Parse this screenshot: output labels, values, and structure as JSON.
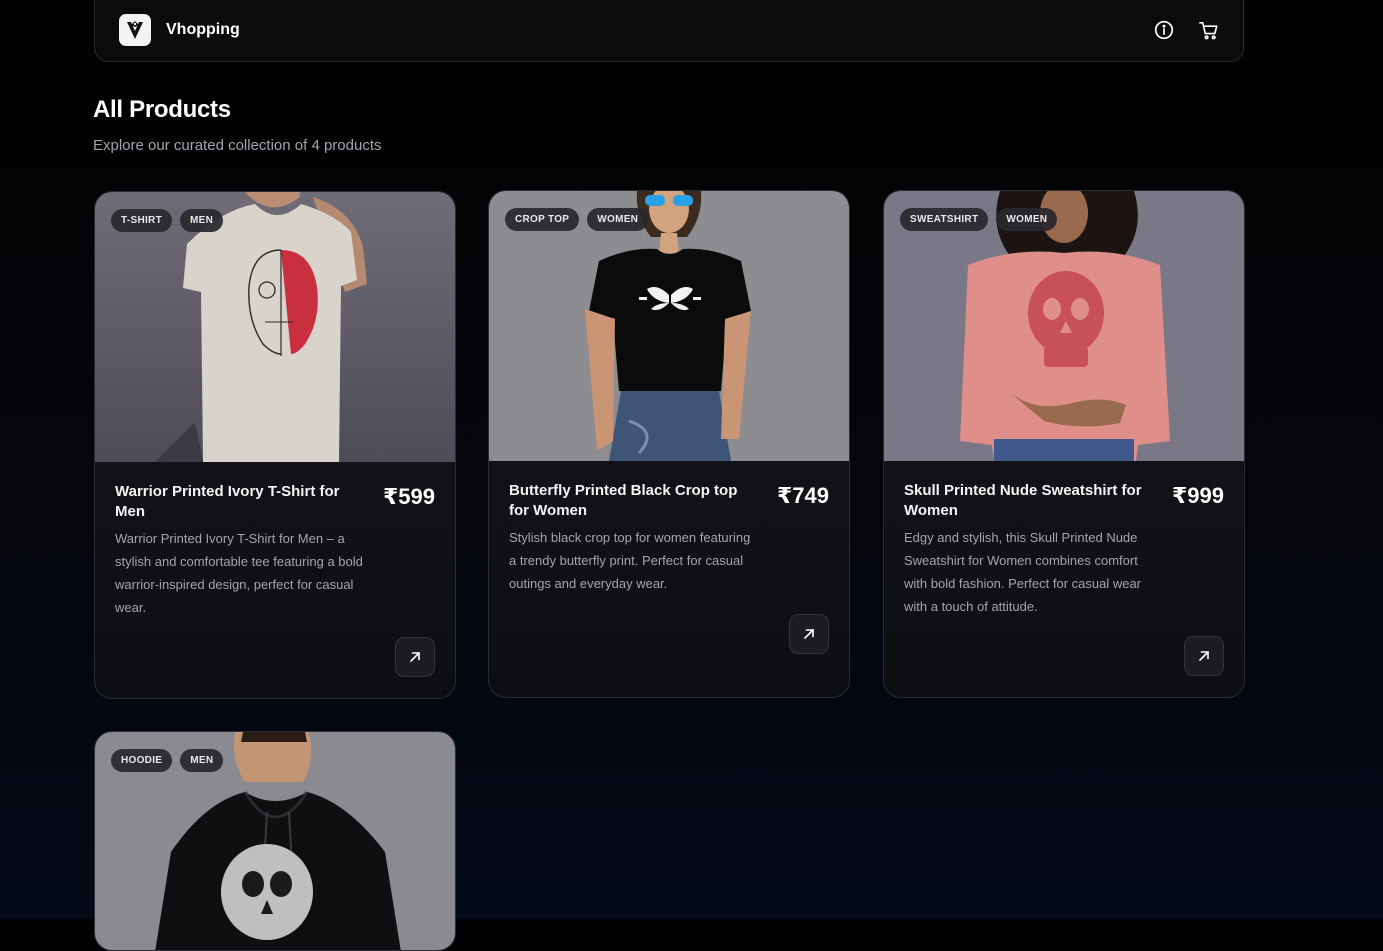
{
  "nav": {
    "brand": "Vhopping",
    "icons": {
      "info": "info-icon",
      "cart": "cart-icon"
    }
  },
  "page": {
    "title": "All Products",
    "subtitle": "Explore our curated collection of 4 products"
  },
  "products": [
    {
      "tags": [
        "T-SHIRT",
        "MEN"
      ],
      "title": "Warrior Printed Ivory T-Shirt for Men",
      "price": "₹599",
      "description": "Warrior Printed Ivory T-Shirt for Men – a stylish and comfortable tee featuring a bold warrior-inspired design, perfect for casual wear."
    },
    {
      "tags": [
        "CROP TOP",
        "WOMEN"
      ],
      "title": "Butterfly Printed Black Crop top for Women",
      "price": "₹749",
      "description": "Stylish black crop top for women featuring a trendy butterfly print. Perfect for casual outings and everyday wear."
    },
    {
      "tags": [
        "SWEATSHIRT",
        "WOMEN"
      ],
      "title": "Skull Printed Nude Sweatshirt for Women",
      "price": "₹999",
      "description": "Edgy and stylish, this Skull Printed Nude Sweatshirt for Women combines comfort with bold fashion. Perfect for casual wear with a touch of attitude."
    },
    {
      "tags": [
        "HOODIE",
        "MEN"
      ],
      "title": "",
      "price": "",
      "description": ""
    }
  ],
  "colors": {
    "background": "#020202",
    "card": "#111216",
    "text_muted": "#a4a4aa"
  }
}
